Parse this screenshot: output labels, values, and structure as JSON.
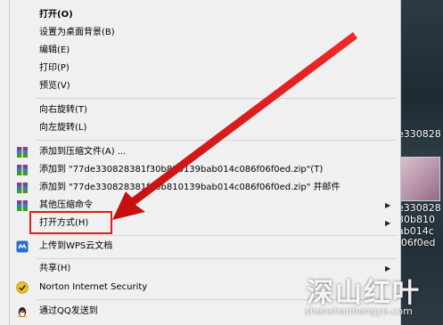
{
  "menu": {
    "items": [
      {
        "id": "open",
        "label": "打开(O)",
        "bold": true,
        "icon": null,
        "arrow": false
      },
      {
        "id": "set-wallpaper",
        "label": "设置为桌面背景(B)",
        "icon": null,
        "arrow": false
      },
      {
        "id": "edit",
        "label": "编辑(E)",
        "icon": null,
        "arrow": false
      },
      {
        "id": "print",
        "label": "打印(P)",
        "icon": null,
        "arrow": false
      },
      {
        "id": "preview",
        "label": "预览(V)",
        "icon": null,
        "arrow": false
      },
      {
        "id": "rotate-right",
        "label": "向右旋转(T)",
        "icon": null,
        "arrow": false
      },
      {
        "id": "rotate-left",
        "label": "向左旋转(L)",
        "icon": null,
        "arrow": false
      },
      {
        "id": "add-archive",
        "label": "添加到压缩文件(A) ...",
        "icon": "winrar-icon",
        "arrow": false
      },
      {
        "id": "add-to-zip",
        "label": "添加到 \"77de330828381f30b810139bab014c086f06f0ed.zip\"(T)",
        "icon": "winrar-icon",
        "arrow": false
      },
      {
        "id": "add-zip-email",
        "label": "添加到 \"77de330828381f30b810139bab014c086f06f0ed.zip\" 并邮件",
        "icon": "winrar-icon",
        "arrow": false
      },
      {
        "id": "other-compress",
        "label": "其他压缩命令",
        "icon": "winrar-icon",
        "arrow": true
      },
      {
        "id": "open-with",
        "label": "打开方式(H)",
        "icon": null,
        "arrow": true
      },
      {
        "id": "upload-wps",
        "label": "上传到WPS云文档",
        "icon": "wps-cloud-icon",
        "arrow": false
      },
      {
        "id": "share",
        "label": "共享(H)",
        "icon": null,
        "arrow": true
      },
      {
        "id": "norton",
        "label": "Norton Internet Security",
        "icon": "norton-icon",
        "arrow": false
      },
      {
        "id": "qq-send",
        "label": "通过QQ发送到",
        "icon": "qq-penguin-icon",
        "arrow": false
      }
    ]
  },
  "desktop": {
    "labels": [
      "e330828",
      "e330828",
      "30b810",
      "ab014c",
      "f06f0ed"
    ]
  },
  "watermark": {
    "title": "深山红叶",
    "url": "shenshanhongye.com"
  },
  "colors": {
    "annotation_red": "#e01b1b",
    "menu_bg": "#f0f0f0"
  }
}
